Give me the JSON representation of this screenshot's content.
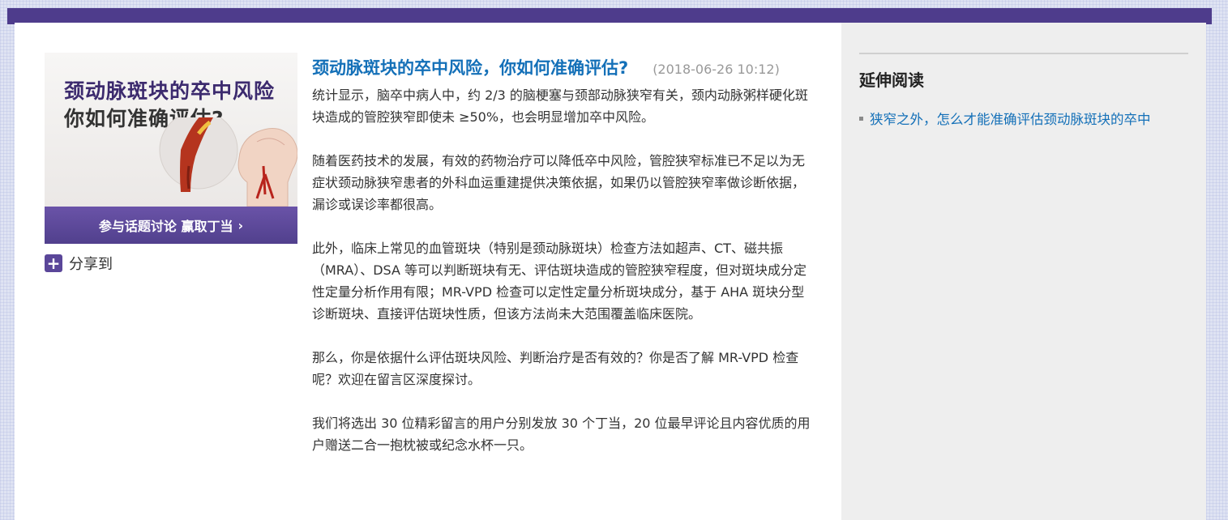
{
  "promo": {
    "headline_line1": "颈动脉斑块的卒中风险",
    "headline_line2": "你如何准确评估?",
    "cta_label": "参与话题讨论 赢取丁当",
    "cta_icon": "chevron-right-icon"
  },
  "share": {
    "label": "分享到",
    "icon": "plus-icon"
  },
  "article": {
    "title": "颈动脉斑块的卒中风险，你如何准确评估?",
    "timestamp": "(2018-06-26 10:12)",
    "paragraphs": [
      "统计显示，脑卒中病人中，约 2/3 的脑梗塞与颈部动脉狭窄有关，颈内动脉粥样硬化斑块造成的管腔狭窄即使未 ≥50%，也会明显增加卒中风险。",
      "随着医药技术的发展，有效的药物治疗可以降低卒中风险，管腔狭窄标准已不足以为无症状颈动脉狭窄患者的外科血运重建提供决策依据，如果仍以管腔狭窄率做诊断依据，漏诊或误诊率都很高。",
      "此外，临床上常见的血管斑块（特别是颈动脉斑块）检查方法如超声、CT、磁共振（MRA）、DSA 等可以判断斑块有无、评估斑块造成的管腔狭窄程度，但对斑块成分定性定量分析作用有限；MR-VPD 检查可以定性定量分析斑块成分，基于 AHA 斑块分型诊断斑块、直接评估斑块性质，但该方法尚未大范围覆盖临床医院。",
      "那么，你是依据什么评估斑块风险、判断治疗是否有效的？你是否了解 MR-VPD 检查呢？欢迎在留言区深度探讨。",
      "我们将选出 30 位精彩留言的用户分别发放 30 个丁当，20 位最早评论且内容优质的用户赠送二合一抱枕被或纪念水杯一只。"
    ]
  },
  "sidebar": {
    "heading": "延伸阅读",
    "items": [
      {
        "label": "狭窄之外，怎么才能准确评估颈动脉斑块的卒中"
      }
    ]
  },
  "colors": {
    "brand_purple": "#4e3c8c",
    "link_blue": "#1470b8",
    "text": "#333333",
    "muted": "#999999"
  }
}
